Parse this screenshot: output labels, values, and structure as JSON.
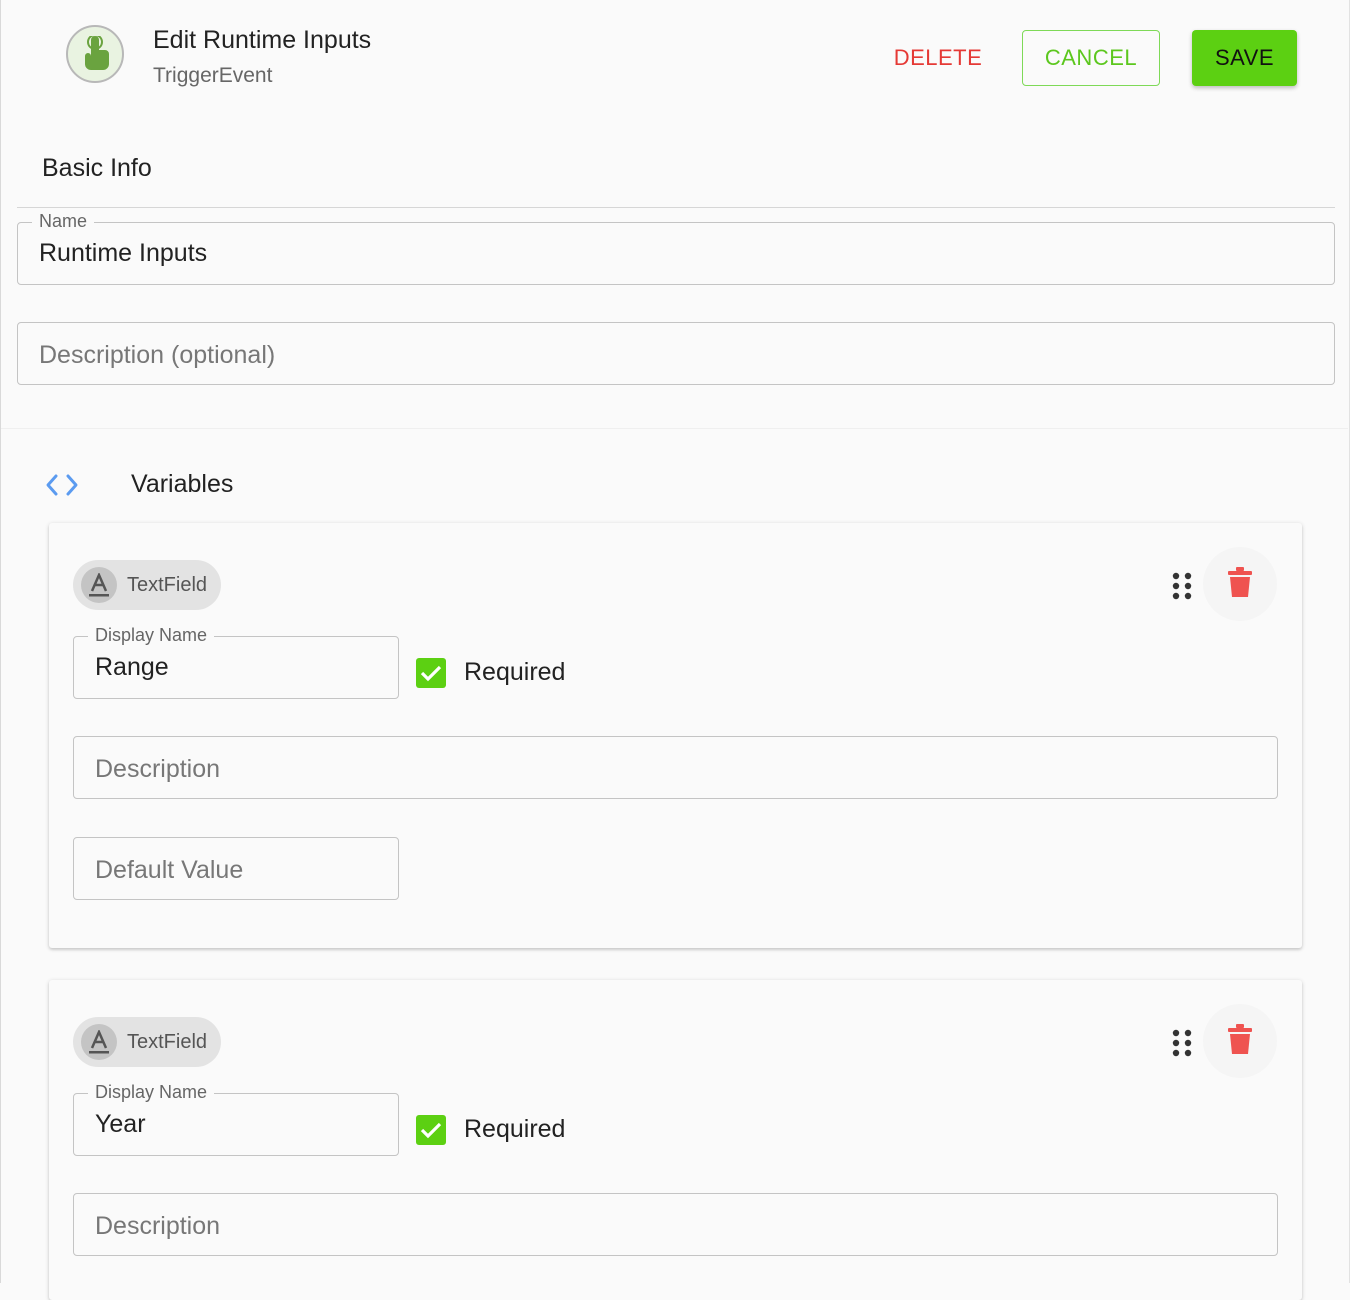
{
  "header": {
    "title": "Edit Runtime Inputs",
    "subtitle": "TriggerEvent",
    "icon": "touch-hand-icon",
    "delete_label": "DELETE",
    "cancel_label": "CANCEL",
    "save_label": "SAVE"
  },
  "basic_info": {
    "section_title": "Basic Info",
    "name_label": "Name",
    "name_value": "Runtime Inputs",
    "description_placeholder": "Description (optional)"
  },
  "variables": {
    "section_title": "Variables",
    "items": [
      {
        "type_label": "TextField",
        "display_name_label": "Display Name",
        "display_name_value": "Range",
        "required_label": "Required",
        "required": true,
        "description_placeholder": "Description",
        "default_value_placeholder": "Default Value"
      },
      {
        "type_label": "TextField",
        "display_name_label": "Display Name",
        "display_name_value": "Year",
        "required_label": "Required",
        "required": true,
        "description_placeholder": "Description"
      }
    ]
  },
  "colors": {
    "accent_green": "#5cd012",
    "delete_red": "#e53935",
    "link_blue": "#5b9bf0"
  }
}
